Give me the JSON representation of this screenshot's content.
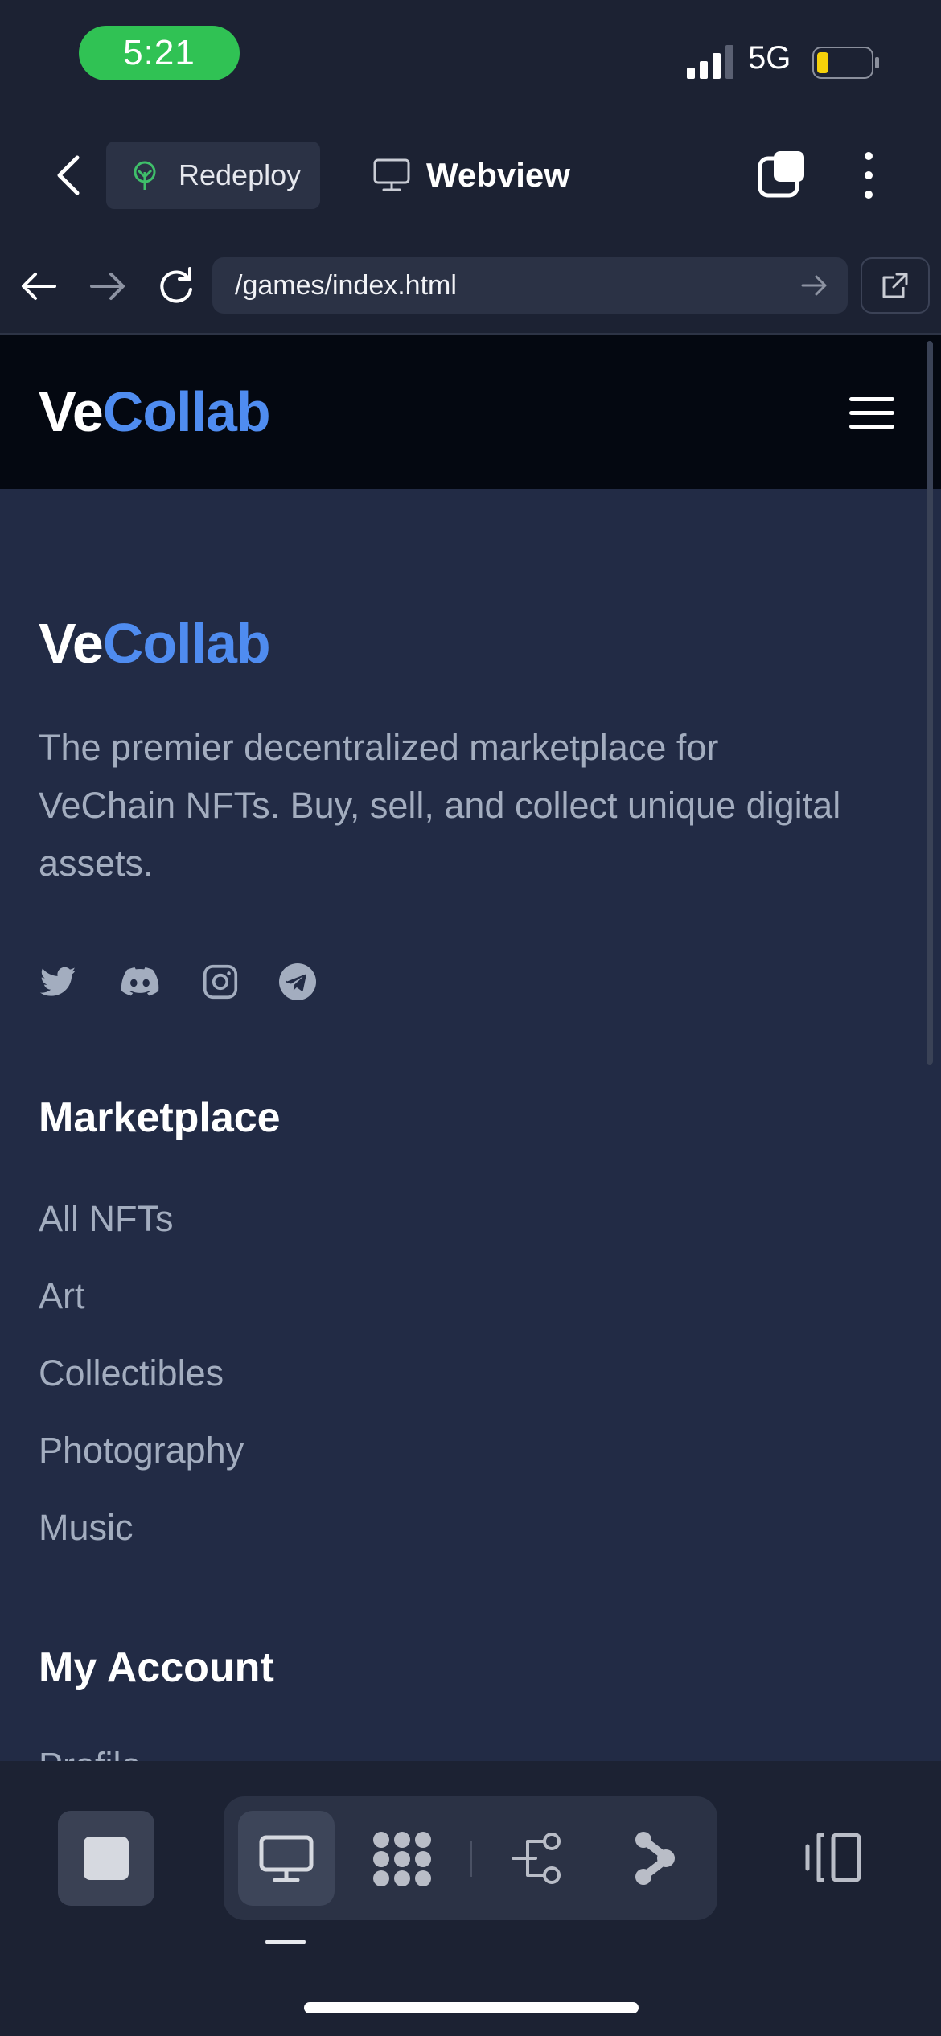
{
  "status_bar": {
    "time": "5:21",
    "network": "5G",
    "battery_level": 0.2,
    "signal_bars": 3
  },
  "header": {
    "redeploy_label": "Redeploy",
    "title": "Webview"
  },
  "browser": {
    "url": "/games/index.html"
  },
  "site": {
    "brand_part1": "Ve",
    "brand_part2": "Collab",
    "description": "The premier decentralized marketplace for VeChain NFTs. Buy, sell, and collect unique digital assets.",
    "socials": [
      "twitter-icon",
      "discord-icon",
      "instagram-icon",
      "telegram-icon"
    ],
    "marketplace": {
      "title": "Marketplace",
      "links": [
        "All NFTs",
        "Art",
        "Collectibles",
        "Photography",
        "Music"
      ]
    },
    "account": {
      "title": "My Account",
      "first_link": "Profile"
    }
  },
  "colors": {
    "accent": "#4f8cf0",
    "time_pill": "#30c254",
    "battery": "#f5d10a"
  }
}
